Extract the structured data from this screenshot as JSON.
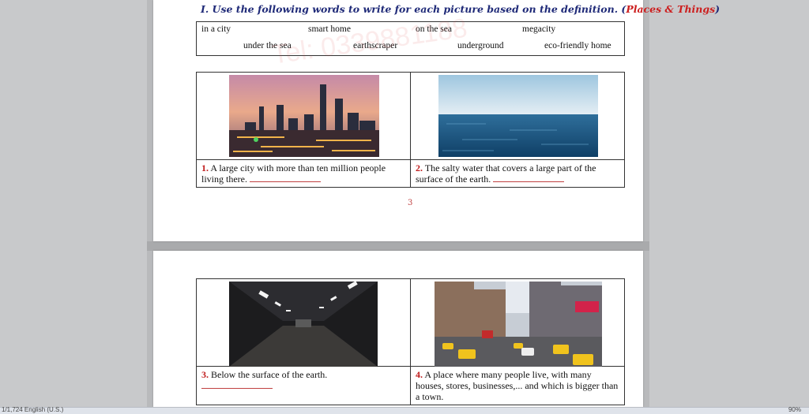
{
  "heading": {
    "prefix": "I. Use the following words to write for each picture based on the definition. (",
    "accent": "Places & Things",
    "suffix": ")"
  },
  "watermark": "Tel: 0339881188",
  "words": [
    "in a city",
    "smart home",
    "on the sea",
    "megacity",
    "under the sea",
    "earthscraper",
    "underground",
    "eco-friendly home"
  ],
  "items": [
    {
      "num": "1.",
      "text": "A large city with more than ten million people living there."
    },
    {
      "num": "2.",
      "text": "The salty water that covers a large part of the surface of the earth."
    },
    {
      "num": "3.",
      "text": "Below the surface of the earth."
    },
    {
      "num": "4.",
      "text": "A place where many people live, with many houses, stores, businesses,... and which is bigger than a town."
    }
  ],
  "page_number": "3",
  "status": {
    "left": "1/1,724   English (U.S.)",
    "zoom": "90%"
  }
}
